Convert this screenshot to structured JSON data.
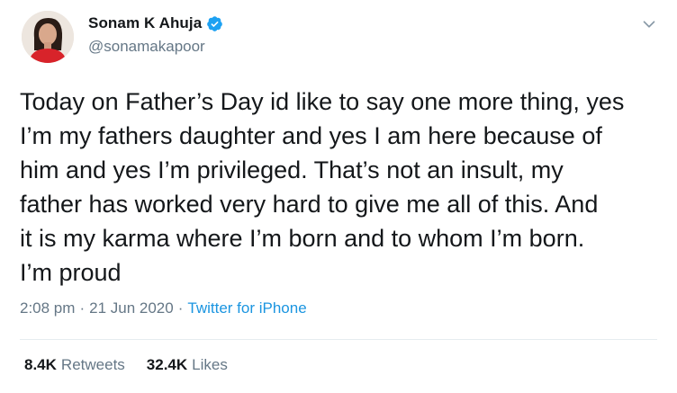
{
  "author": {
    "display_name": "Sonam K Ahuja",
    "handle": "@sonamakapoor",
    "verified": true,
    "verified_icon": "verified-badge-icon"
  },
  "tweet": {
    "text": "Today on Father’s Day id like to say one more thing, yes\nI’m my fathers daughter and yes I am here because of\nhim and yes I’m privileged. That’s not an insult, my\nfather has worked very hard to give me all of this. And\nit is my karma where I’m born and to whom I’m born.\nI’m proud"
  },
  "meta": {
    "time": "2:08 pm",
    "separator": "·",
    "date": "21 Jun 2020",
    "source": "Twitter for iPhone"
  },
  "stats": {
    "retweets_count": "8.4K",
    "retweets_label": "Retweets",
    "likes_count": "32.4K",
    "likes_label": "Likes"
  },
  "colors": {
    "link": "#1b95e0",
    "secondary_text": "#657786",
    "verified": "#1da1f2",
    "divider": "#e6ecf0"
  }
}
